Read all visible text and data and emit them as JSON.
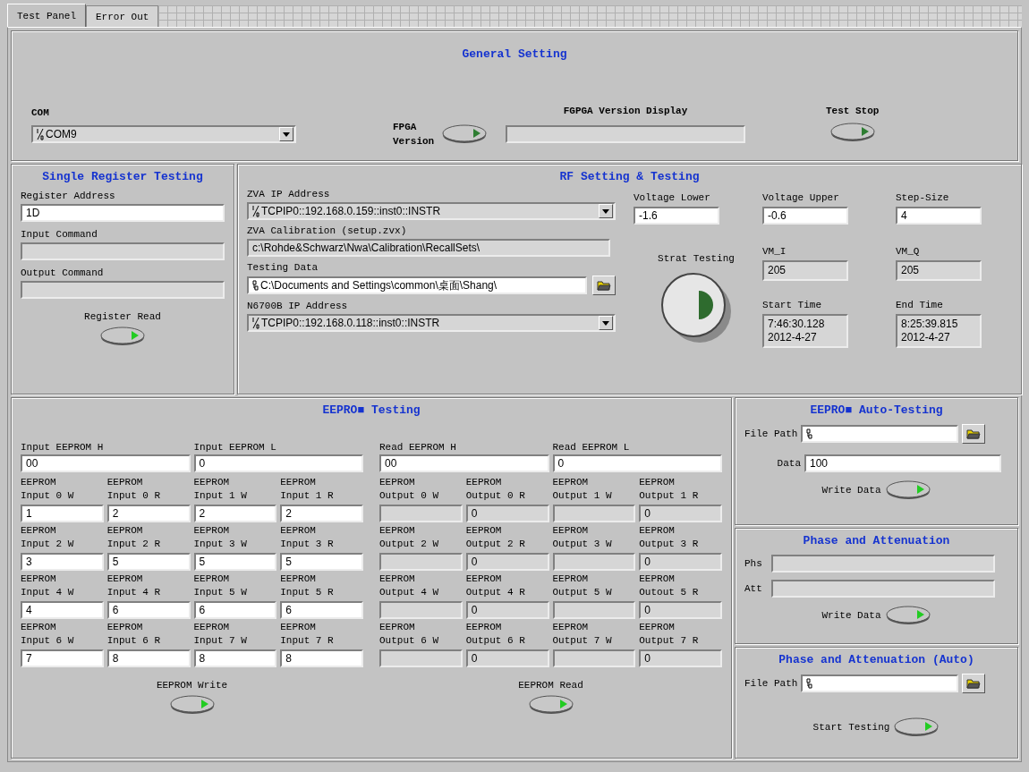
{
  "tabs": [
    {
      "label": "Test Panel",
      "selected": true
    },
    {
      "label": "Error Out",
      "selected": false
    }
  ],
  "general": {
    "title": "General Setting",
    "com": {
      "label": "COM",
      "value": "COM9"
    },
    "fpga_button": {
      "label": "FPGA Version"
    },
    "version_display": {
      "label": "FGPGA Version Display"
    },
    "stop_button": {
      "label": "Test Stop"
    }
  },
  "single_register": {
    "title": "Single Register Testing",
    "fields": [
      {
        "label": "Register Address",
        "value": "1D",
        "kind": "control"
      },
      {
        "label": "Input Command",
        "kind": "indicator"
      },
      {
        "label": "Output Command",
        "kind": "indicator"
      }
    ],
    "read_button": {
      "label": "Register Read"
    }
  },
  "rf": {
    "title": "RF Setting & Testing",
    "left": [
      {
        "label": "ZVA IP Address",
        "value": "TCPIP0::192.168.0.159::inst0::INSTR",
        "kind": "resource"
      },
      {
        "label": "ZVA Calibration (setup.zvx)",
        "value": "c:\\Rohde&Schwarz\\Nwa\\Calibration\\RecallSets\\",
        "kind": "indicator"
      },
      {
        "label": "Testing Data",
        "value": "C:\\Documents and Settings\\common\\桌面\\Shang\\",
        "kind": "path"
      },
      {
        "label": "N6700B IP Address",
        "value": "TCPIP0::192.168.0.118::inst0::INSTR",
        "kind": "resource"
      }
    ],
    "settings": [
      {
        "label": "Voltage Lower",
        "value": "-1.6",
        "kind": "control"
      },
      {
        "label": "Voltage Upper",
        "value": "-0.6",
        "kind": "control"
      },
      {
        "label": "Step-Size",
        "value": "4",
        "kind": "control"
      }
    ],
    "start_button": {
      "label": "Strat Testing"
    },
    "readings": [
      {
        "label": "VM_I",
        "value": "205",
        "kind": "indicator"
      },
      {
        "label": "VM_Q",
        "value": "205",
        "kind": "indicator"
      },
      {
        "label": "Start Time",
        "value": "7:46:30.128\n2012-4-27",
        "kind": "indicator"
      },
      {
        "label": "End Time",
        "value": "8:25:39.815\n2012-4-27",
        "kind": "indicator"
      }
    ]
  },
  "eeprom": {
    "title": "EEPRO■ Testing",
    "halves": [
      {
        "high": {
          "label": "Input EEPROM H",
          "value": "00",
          "kind": "control"
        },
        "low": {
          "label": "Input EEPROM L",
          "value": "0",
          "kind": "control"
        },
        "cells": [
          {
            "label": "EEPROM Input 0 W",
            "value": "1",
            "kind": "control"
          },
          {
            "label": "EEPROM Input 0 R",
            "value": "2",
            "kind": "control"
          },
          {
            "label": "EEPROM Input 1 W",
            "value": "2",
            "kind": "control"
          },
          {
            "label": "EEPROM Input 1 R",
            "value": "2",
            "kind": "control"
          },
          {
            "label": "EEPROM Input 2 W",
            "value": "3",
            "kind": "control"
          },
          {
            "label": "EEPROM Input 2 R",
            "value": "5",
            "kind": "control"
          },
          {
            "label": "EEPROM Input 3 W",
            "value": "5",
            "kind": "control"
          },
          {
            "label": "EEPROM Input 3 R",
            "value": "5",
            "kind": "control"
          },
          {
            "label": "EEPROM Input 4 W",
            "value": "4",
            "kind": "control"
          },
          {
            "label": "EEPROM Input 4 R",
            "value": "6",
            "kind": "control"
          },
          {
            "label": "EEPROM Input 5 W",
            "value": "6",
            "kind": "control"
          },
          {
            "label": "EEPROM Input 5 R",
            "value": "6",
            "kind": "control"
          },
          {
            "label": "EEPROM Input 6 W",
            "value": "7",
            "kind": "control"
          },
          {
            "label": "EEPROM Input 6 R",
            "value": "8",
            "kind": "control"
          },
          {
            "label": "EEPROM Input 7 W",
            "value": "8",
            "kind": "control"
          },
          {
            "label": "EEPROM Input 7 R",
            "value": "8",
            "kind": "control"
          }
        ],
        "button": {
          "label": "EEPROM Write"
        }
      },
      {
        "high": {
          "label": "Read EEPROM H",
          "value": "00",
          "kind": "control"
        },
        "low": {
          "label": "Read EEPROM L",
          "value": "0",
          "kind": "control"
        },
        "cells": [
          {
            "label": "EEPROM Output 0 W",
            "kind": "indicator"
          },
          {
            "label": "EEPROM Output 0 R",
            "value": "0",
            "kind": "indicator"
          },
          {
            "label": "EEPROM Output 1 W",
            "kind": "indicator"
          },
          {
            "label": "EEPROM Output 1 R",
            "value": "0",
            "kind": "indicator"
          },
          {
            "label": "EEPROM Output 2 W",
            "kind": "indicator"
          },
          {
            "label": "EEPROM Output 2 R",
            "value": "0",
            "kind": "indicator"
          },
          {
            "label": "EEPROM Output 3 W",
            "kind": "indicator"
          },
          {
            "label": "EEPROM Output 3 R",
            "value": "0",
            "kind": "indicator"
          },
          {
            "label": "EEPROM Output 4 W",
            "kind": "indicator"
          },
          {
            "label": "EEPROM Output 4 R",
            "value": "0",
            "kind": "indicator"
          },
          {
            "label": "EEPROM Output 5 W",
            "kind": "indicator"
          },
          {
            "label": "Outout 5 R",
            "kind": "indicator",
            "value": "0",
            "prefix": "EEPROM"
          },
          {
            "label": "EEPROM Output 6 W",
            "kind": "indicator"
          },
          {
            "label": "EEPROM Output 6 R",
            "value": "0",
            "kind": "indicator"
          },
          {
            "label": "EEPROM Output 7 W",
            "kind": "indicator"
          },
          {
            "label": "EEPROM Output 7 R",
            "value": "0",
            "kind": "indicator"
          }
        ],
        "button": {
          "label": "EEPROM Read"
        }
      }
    ]
  },
  "auto_testing": {
    "title": "EEPRO■ Auto-Testing",
    "file_path": {
      "label": "File Path"
    },
    "data": {
      "label": "Data",
      "value": "100"
    },
    "button": {
      "label": "Write Data"
    }
  },
  "phase_attenuation": {
    "title": "Phase and Attenuation",
    "fields": [
      {
        "label": "Phs"
      },
      {
        "label": "Att"
      }
    ],
    "button": {
      "label": "Write Data"
    }
  },
  "phase_attenuation_auto": {
    "title": "Phase and Attenuation (Auto)",
    "file_path": {
      "label": "File Path"
    },
    "button": {
      "label": "Start Testing"
    }
  }
}
